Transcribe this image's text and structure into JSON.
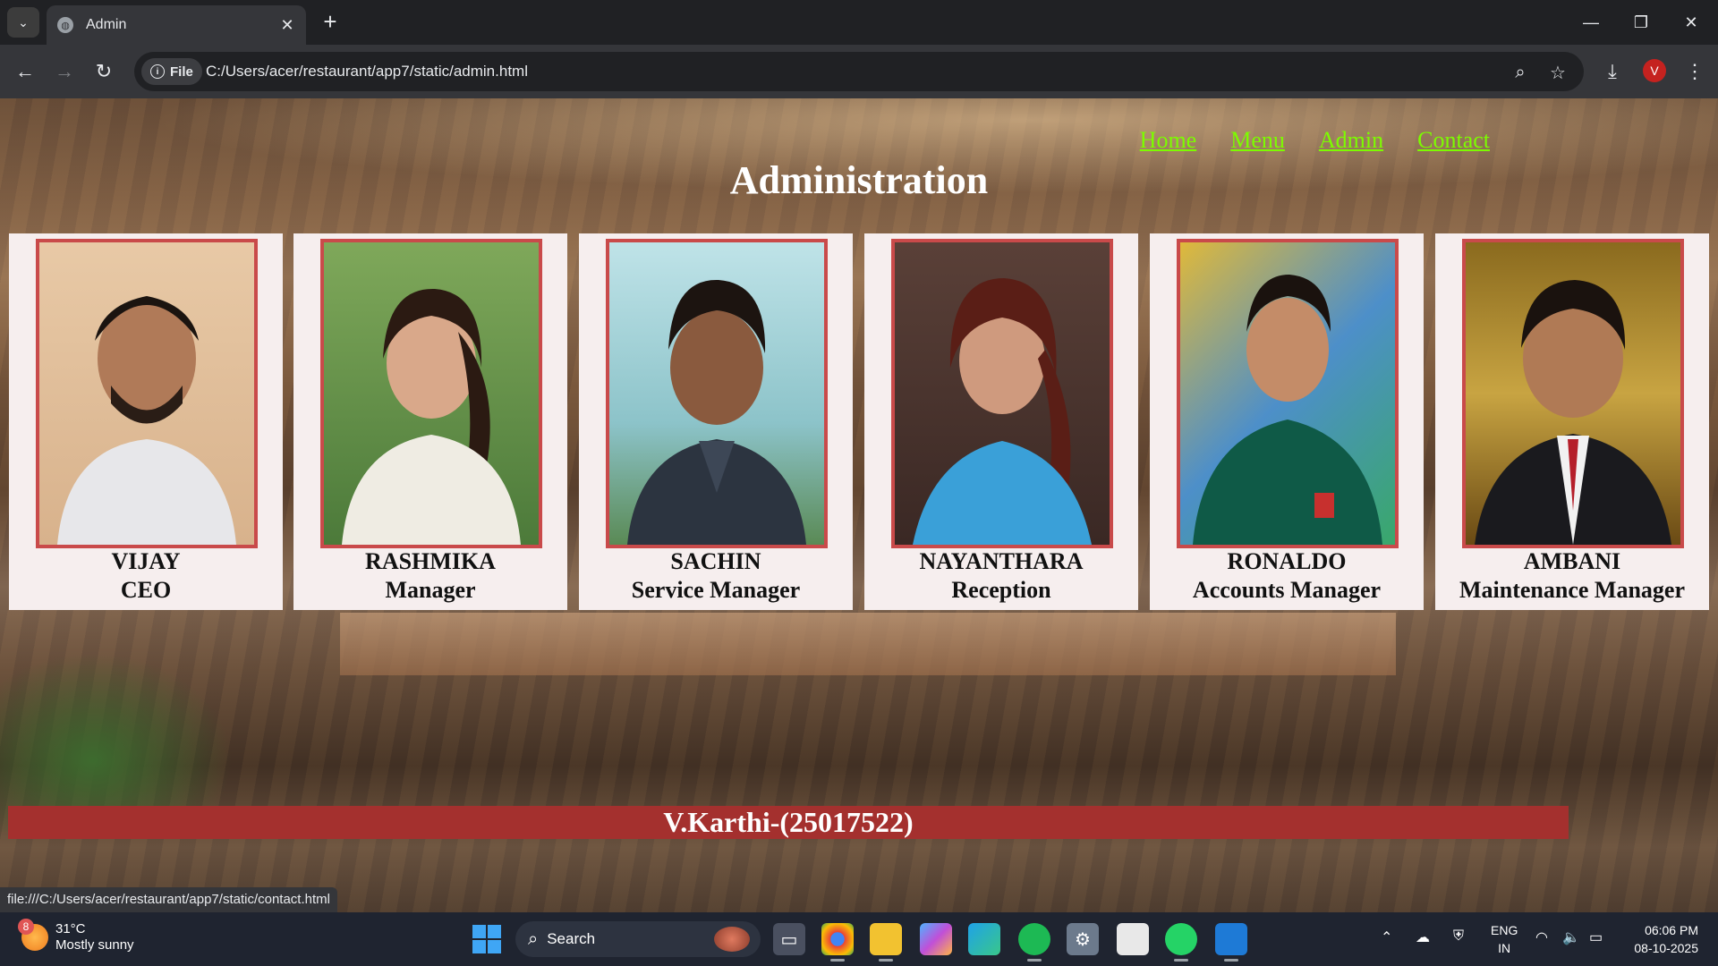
{
  "browser": {
    "tab_title": "Admin",
    "new_tab_symbol": "+",
    "url_chip": "File",
    "url": "C:/Users/acer/restaurant/app7/static/admin.html",
    "profile_initial": "V"
  },
  "page": {
    "nav": [
      "Home",
      "Menu",
      "Admin",
      "Contact"
    ],
    "title": "Administration",
    "staff": [
      {
        "name": "VIJAY",
        "role": "CEO"
      },
      {
        "name": "RASHMIKA",
        "role": "Manager"
      },
      {
        "name": "SACHIN",
        "role": "Service Manager"
      },
      {
        "name": "NAYANTHARA",
        "role": "Reception"
      },
      {
        "name": "RONALDO",
        "role": "Accounts Manager"
      },
      {
        "name": "AMBANI",
        "role": "Maintenance Manager"
      }
    ],
    "footer": "V.Karthi-(25017522)",
    "status_url": "file:///C:/Users/acer/restaurant/app7/static/contact.html"
  },
  "taskbar": {
    "weather_badge": "8",
    "temperature": "31°C",
    "weather_desc": "Mostly sunny",
    "search_label": "Search",
    "lang_line1": "ENG",
    "lang_line2": "IN",
    "time": "06:06 PM",
    "date": "08-10-2025"
  },
  "colors": {
    "nav_link": "#7cfc00",
    "card_bg": "#f6eeee",
    "photo_border": "#c94a4a",
    "footer_bg": "#a4302e"
  }
}
